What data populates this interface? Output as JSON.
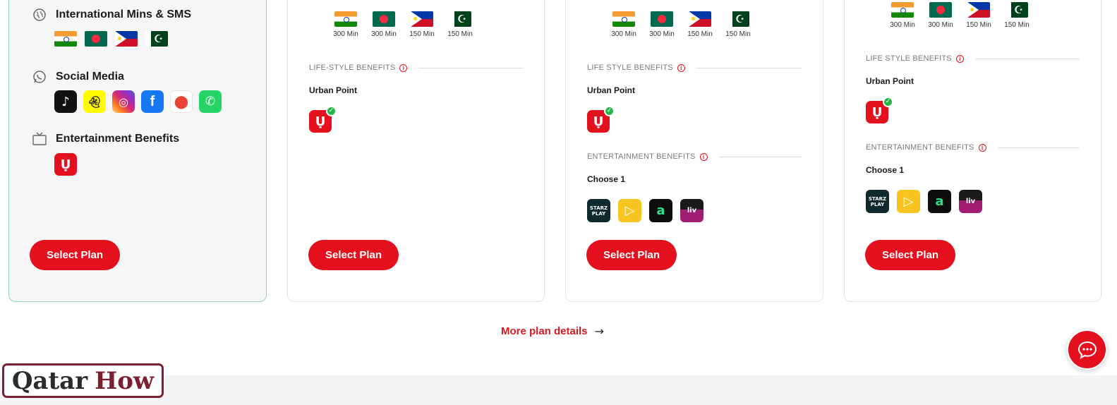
{
  "colors": {
    "accent": "#e4101d",
    "link": "#d71920",
    "selected_border": "#8fd3c3"
  },
  "card1": {
    "features": [
      {
        "icon": "globe-icon",
        "title": "International Mins & SMS"
      },
      {
        "icon": "whatsapp-outline-icon",
        "title": "Social Media"
      },
      {
        "icon": "tv-icon",
        "title": "Entertainment Benefits"
      }
    ],
    "flags": [
      "india-flag-icon",
      "bangladesh-flag-icon",
      "philippines-flag-icon",
      "pakistan-flag-icon"
    ],
    "social_apps": [
      "tiktok-icon",
      "snapchat-icon",
      "instagram-icon",
      "facebook-icon",
      "google-maps-icon",
      "whatsapp-icon"
    ],
    "entertainment_apps": [
      "urban-point-icon"
    ],
    "select_label": "Select Plan"
  },
  "card2": {
    "roaming": [
      {
        "flag": "india-flag-icon",
        "label": "300 Min"
      },
      {
        "flag": "bangladesh-flag-icon",
        "label": "300 Min"
      },
      {
        "flag": "philippines-flag-icon",
        "label": "150 Min"
      },
      {
        "flag": "pakistan-flag-icon",
        "label": "150 Min"
      }
    ],
    "lifestyle_title": "LIFE-STYLE BENEFITS",
    "lifestyle_item": "Urban Point",
    "select_label": "Select Plan"
  },
  "card3": {
    "roaming": [
      {
        "flag": "india-flag-icon",
        "label": "300 Min"
      },
      {
        "flag": "bangladesh-flag-icon",
        "label": "300 Min"
      },
      {
        "flag": "philippines-flag-icon",
        "label": "150 Min"
      },
      {
        "flag": "pakistan-flag-icon",
        "label": "150 Min"
      }
    ],
    "lifestyle_title": "LIFE STYLE BENEFITS",
    "lifestyle_item": "Urban Point",
    "entertainment_title": "ENTERTAINMENT BENEFITS",
    "entertainment_sub": "Choose 1",
    "entertainment_apps": [
      "starzplay-icon",
      "vu-icon",
      "aha-icon",
      "sonyliv-icon"
    ],
    "select_label": "Select Plan"
  },
  "card4": {
    "roaming": [
      {
        "flag": "india-flag-icon",
        "label": "300 Min"
      },
      {
        "flag": "bangladesh-flag-icon",
        "label": "300 Min"
      },
      {
        "flag": "philippines-flag-icon",
        "label": "150 Min"
      },
      {
        "flag": "pakistan-flag-icon",
        "label": "150 Min"
      }
    ],
    "lifestyle_title": "LIFE STYLE BENEFITS",
    "lifestyle_item": "Urban Point",
    "entertainment_title": "ENTERTAINMENT BENEFITS",
    "entertainment_sub": "Choose 1",
    "entertainment_apps": [
      "starzplay-icon",
      "vu-icon",
      "aha-icon",
      "sonyliv-icon"
    ],
    "select_label": "Select Plan"
  },
  "more_link": {
    "label": "More plan details",
    "arrow": "→"
  },
  "chat": {
    "icon": "chat-bubble-icon"
  },
  "watermark": {
    "word1": "Qatar",
    "word2": "How"
  }
}
